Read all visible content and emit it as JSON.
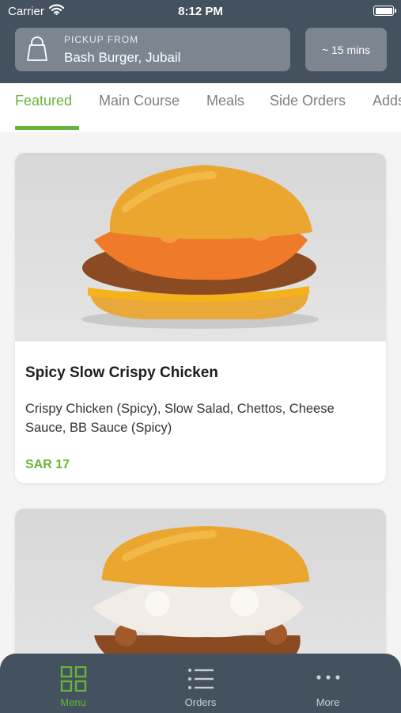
{
  "status_bar": {
    "carrier": "Carrier",
    "time": "8:12 PM"
  },
  "pickup": {
    "label": "PICKUP FROM",
    "store": "Bash Burger, Jubail",
    "eta": "~ 15 mins"
  },
  "tabs": [
    {
      "label": "Featured",
      "active": true
    },
    {
      "label": "Main Course",
      "active": false
    },
    {
      "label": "Meals",
      "active": false
    },
    {
      "label": "Side Orders",
      "active": false
    },
    {
      "label": "Adds",
      "active": false
    }
  ],
  "items": [
    {
      "name": "Spicy Slow Crispy Chicken",
      "description": "Crispy Chicken (Spicy), Slow Salad, Chettos, Cheese Sauce, BB Sauce (Spicy)",
      "price": "SAR 17"
    }
  ],
  "bottom_nav": [
    {
      "label": "Menu",
      "icon": "grid-icon",
      "active": true
    },
    {
      "label": "Orders",
      "icon": "list-icon",
      "active": false
    },
    {
      "label": "More",
      "icon": "more-dots-icon",
      "active": false
    }
  ],
  "colors": {
    "header": "#44525f",
    "accent": "#68b33a",
    "pickup_box": "#7b8690",
    "background": "#f4f4f4"
  }
}
